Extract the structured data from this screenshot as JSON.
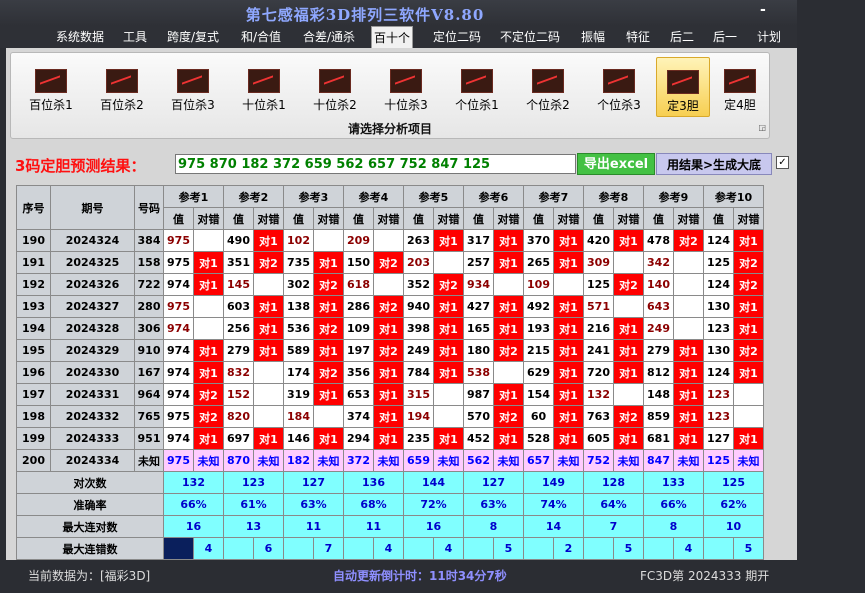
{
  "window": {
    "title": "第七感福彩3D排列三软件V8.80",
    "minimize": "-"
  },
  "menu": [
    "系统数据",
    "工具",
    "跨度/复式",
    "和/合值",
    "合差/通杀",
    "百十个",
    "定位二码",
    "不定位二码",
    "振幅",
    "特征",
    "后二",
    "后一",
    "计划"
  ],
  "ribbon": {
    "buttons": [
      "百位杀1",
      "百位杀2",
      "百位杀3",
      "十位杀1",
      "十位杀2",
      "十位杀3",
      "个位杀1",
      "个位杀2",
      "个位杀3",
      "定3胆",
      "定4胆"
    ],
    "caption": "请选择分析项目"
  },
  "prediction": {
    "label": "3码定胆预测结果：",
    "value": "975 870 182 372 659 562 657 752 847 125",
    "excel_button": "导出excel",
    "generate_button": "用结果>生成大底",
    "checkbox": "✓"
  },
  "table": {
    "headers": {
      "seq": "序号",
      "period": "期号",
      "number": "号码",
      "refs": [
        "参考1",
        "参考2",
        "参考3",
        "参考4",
        "参考5",
        "参考6",
        "参考7",
        "参考8",
        "参考9",
        "参考10"
      ],
      "value": "值",
      "hit": "对错"
    },
    "rows": [
      {
        "seq": "190",
        "period": "2024324",
        "num": "384",
        "cells": [
          [
            "975",
            ""
          ],
          [
            "490",
            "对1"
          ],
          [
            "102",
            ""
          ],
          [
            "209",
            ""
          ],
          [
            "263",
            "对1"
          ],
          [
            "317",
            "对1"
          ],
          [
            "370",
            "对1"
          ],
          [
            "420",
            "对1"
          ],
          [
            "478",
            "对2"
          ],
          [
            "124",
            "对1"
          ]
        ]
      },
      {
        "seq": "191",
        "period": "2024325",
        "num": "158",
        "cells": [
          [
            "975",
            "对1"
          ],
          [
            "351",
            "对2"
          ],
          [
            "735",
            "对1"
          ],
          [
            "150",
            "对2"
          ],
          [
            "203",
            ""
          ],
          [
            "257",
            "对1"
          ],
          [
            "265",
            "对1"
          ],
          [
            "309",
            ""
          ],
          [
            "342",
            ""
          ],
          [
            "125",
            "对2"
          ]
        ]
      },
      {
        "seq": "192",
        "period": "2024326",
        "num": "722",
        "cells": [
          [
            "974",
            "对1"
          ],
          [
            "145",
            ""
          ],
          [
            "302",
            "对2"
          ],
          [
            "618",
            ""
          ],
          [
            "352",
            "对2"
          ],
          [
            "934",
            ""
          ],
          [
            "109",
            ""
          ],
          [
            "125",
            "对2"
          ],
          [
            "140",
            ""
          ],
          [
            "124",
            "对2"
          ]
        ]
      },
      {
        "seq": "193",
        "period": "2024327",
        "num": "280",
        "cells": [
          [
            "975",
            ""
          ],
          [
            "603",
            "对1"
          ],
          [
            "138",
            "对1"
          ],
          [
            "286",
            "对2"
          ],
          [
            "940",
            "对1"
          ],
          [
            "427",
            "对1"
          ],
          [
            "492",
            "对1"
          ],
          [
            "571",
            ""
          ],
          [
            "643",
            ""
          ],
          [
            "130",
            "对1"
          ]
        ]
      },
      {
        "seq": "194",
        "period": "2024328",
        "num": "306",
        "cells": [
          [
            "974",
            ""
          ],
          [
            "256",
            "对1"
          ],
          [
            "536",
            "对2"
          ],
          [
            "109",
            "对1"
          ],
          [
            "398",
            "对1"
          ],
          [
            "165",
            "对1"
          ],
          [
            "193",
            "对1"
          ],
          [
            "216",
            "对1"
          ],
          [
            "249",
            ""
          ],
          [
            "123",
            "对1"
          ]
        ]
      },
      {
        "seq": "195",
        "period": "2024329",
        "num": "910",
        "cells": [
          [
            "974",
            "对1"
          ],
          [
            "279",
            "对1"
          ],
          [
            "589",
            "对1"
          ],
          [
            "197",
            "对2"
          ],
          [
            "249",
            "对1"
          ],
          [
            "180",
            "对2"
          ],
          [
            "215",
            "对1"
          ],
          [
            "241",
            "对1"
          ],
          [
            "279",
            "对1"
          ],
          [
            "130",
            "对2"
          ]
        ]
      },
      {
        "seq": "196",
        "period": "2024330",
        "num": "167",
        "cells": [
          [
            "974",
            "对1"
          ],
          [
            "832",
            ""
          ],
          [
            "174",
            "对2"
          ],
          [
            "356",
            "对1"
          ],
          [
            "784",
            "对1"
          ],
          [
            "538",
            ""
          ],
          [
            "629",
            "对1"
          ],
          [
            "720",
            "对1"
          ],
          [
            "812",
            "对1"
          ],
          [
            "124",
            "对1"
          ]
        ]
      },
      {
        "seq": "197",
        "period": "2024331",
        "num": "964",
        "cells": [
          [
            "974",
            "对2"
          ],
          [
            "152",
            ""
          ],
          [
            "319",
            "对1"
          ],
          [
            "653",
            "对1"
          ],
          [
            "315",
            ""
          ],
          [
            "987",
            "对1"
          ],
          [
            "154",
            "对1"
          ],
          [
            "132",
            ""
          ],
          [
            "148",
            "对1"
          ],
          [
            "123",
            ""
          ]
        ]
      },
      {
        "seq": "198",
        "period": "2024332",
        "num": "765",
        "cells": [
          [
            "975",
            "对2"
          ],
          [
            "820",
            ""
          ],
          [
            "184",
            ""
          ],
          [
            "374",
            "对1"
          ],
          [
            "194",
            ""
          ],
          [
            "570",
            "对2"
          ],
          [
            "60",
            "对1"
          ],
          [
            "763",
            "对2"
          ],
          [
            "859",
            "对1"
          ],
          [
            "123",
            ""
          ]
        ]
      },
      {
        "seq": "199",
        "period": "2024333",
        "num": "951",
        "cells": [
          [
            "974",
            "对1"
          ],
          [
            "697",
            "对1"
          ],
          [
            "146",
            "对1"
          ],
          [
            "294",
            "对1"
          ],
          [
            "235",
            "对1"
          ],
          [
            "452",
            "对1"
          ],
          [
            "528",
            "对1"
          ],
          [
            "605",
            "对1"
          ],
          [
            "681",
            "对1"
          ],
          [
            "127",
            "对1"
          ]
        ]
      }
    ],
    "predict_row": {
      "seq": "200",
      "period": "2024334",
      "num": "未知",
      "cells": [
        [
          "975",
          "未知"
        ],
        [
          "870",
          "未知"
        ],
        [
          "182",
          "未知"
        ],
        [
          "372",
          "未知"
        ],
        [
          "659",
          "未知"
        ],
        [
          "562",
          "未知"
        ],
        [
          "657",
          "未知"
        ],
        [
          "752",
          "未知"
        ],
        [
          "847",
          "未知"
        ],
        [
          "125",
          "未知"
        ]
      ]
    },
    "stats": [
      {
        "label": "对次数",
        "values": [
          "132",
          "123",
          "127",
          "136",
          "144",
          "127",
          "149",
          "128",
          "133",
          "125"
        ]
      },
      {
        "label": "准确率",
        "values": [
          "66%",
          "61%",
          "63%",
          "68%",
          "72%",
          "63%",
          "74%",
          "64%",
          "66%",
          "62%"
        ]
      },
      {
        "label": "最大连对数",
        "values": [
          "16",
          "13",
          "11",
          "11",
          "16",
          "8",
          "14",
          "7",
          "8",
          "10"
        ]
      },
      {
        "label": "最大连错数",
        "values": [
          "4",
          "6",
          "7",
          "4",
          "4",
          "5",
          "2",
          "5",
          "4",
          "5"
        ]
      }
    ]
  },
  "status": {
    "left": "当前数据为：[福彩3D]",
    "center": "自动更新倒计时：11时34分7秒",
    "right": "FC3D第 2024333 期开"
  }
}
